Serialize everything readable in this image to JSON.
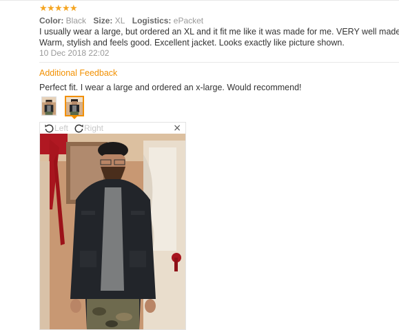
{
  "rating": {
    "stars": 5,
    "star_glyph": "★",
    "color": "#f5a623"
  },
  "attributes": [
    {
      "key": "Color:",
      "value": "Black"
    },
    {
      "key": "Size:",
      "value": "XL"
    },
    {
      "key": "Logistics:",
      "value": "ePacket"
    }
  ],
  "review": {
    "text_line1": "I usually wear a large, but ordered an XL and it fit me like it was made for me. VERY well made",
    "text_line2": "Warm, stylish and feels good. Excellent jacket. Looks exactly like picture shown.",
    "date": "10 Dec 2018 22:02"
  },
  "feedback": {
    "title": "Additional Feedback",
    "text": "Perfect fit. I wear a large and ordered an x-large. Would recommend!",
    "accent_color": "#f29000"
  },
  "thumbnails": [
    {
      "name": "thumbnail-1",
      "selected": false
    },
    {
      "name": "thumbnail-2",
      "selected": true
    }
  ],
  "viewer": {
    "rotate_left_label": "Left",
    "rotate_right_label": "Right",
    "rotate_left_icon": "rotate-left-icon",
    "rotate_right_icon": "rotate-right-icon",
    "close_label": "×",
    "close_icon": "close-icon",
    "photo_subject": "customer-photo-man-in-black-jacket"
  }
}
